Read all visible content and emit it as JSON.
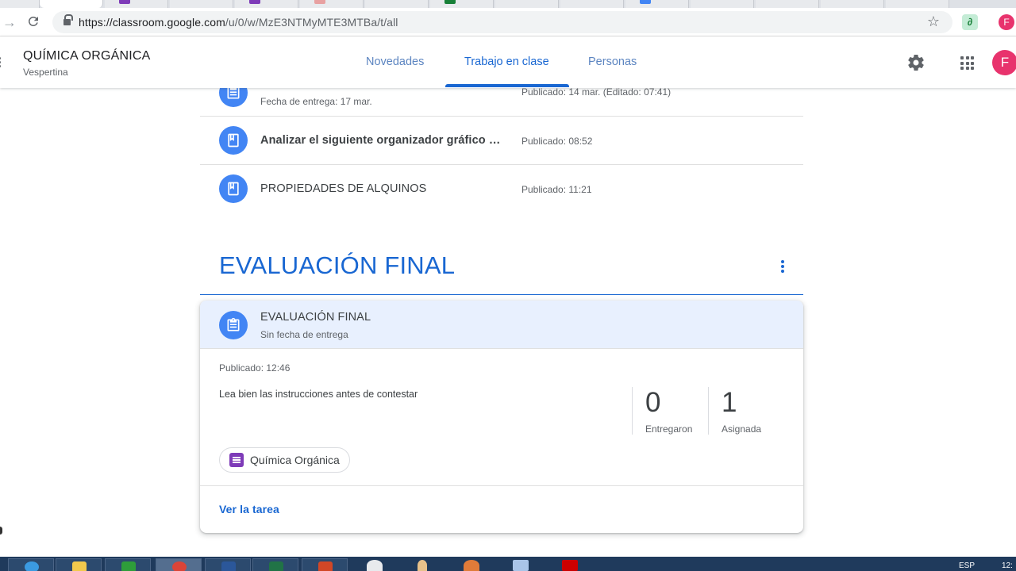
{
  "browser": {
    "url_host": "https://classroom.google.com",
    "url_path": "/u/0/w/MzE3NTMyMTE3MTBa/t/all",
    "profile_initial": "F"
  },
  "header": {
    "class_title": "QUÍMICA ORGÁNICA",
    "class_section": "Vespertina",
    "tabs": [
      {
        "label": "Novedades"
      },
      {
        "label": "Trabajo en clase",
        "active": true
      },
      {
        "label": "Personas"
      }
    ],
    "avatar_initial": "F"
  },
  "items": [
    {
      "title": "",
      "subtitle": "Fecha de entrega: 17 mar.",
      "date": "Publicado: 14 mar. (Editado: 07:41)",
      "icon": "assignment-icon"
    },
    {
      "title": "Analizar el siguiente organizador gráfico qu...",
      "date": "Publicado: 08:52",
      "icon": "material-icon"
    },
    {
      "title": "PROPIEDADES DE ALQUINOS",
      "date": "Publicado: 11:21",
      "icon": "material-icon"
    }
  ],
  "topic": {
    "title": "EVALUACIÓN FINAL"
  },
  "card": {
    "title": "EVALUACIÓN FINAL",
    "due": "Sin fecha de entrega",
    "published": "Publicado: 12:46",
    "description": "Lea bien las instrucciones antes de contestar",
    "stats": [
      {
        "value": "0",
        "label": "Entregaron"
      },
      {
        "value": "1",
        "label": "Asignada"
      }
    ],
    "attachment": "Química Orgánica",
    "view_link": "Ver la tarea"
  },
  "taskbar": {
    "language": "ESP",
    "clock": "12:"
  },
  "colors": {
    "accent": "#1967d2",
    "icon_circle": "#4285f4",
    "card_header": "#e8f0fe",
    "avatar": "#e8336d",
    "forms_purple": "#7e3bb8"
  }
}
